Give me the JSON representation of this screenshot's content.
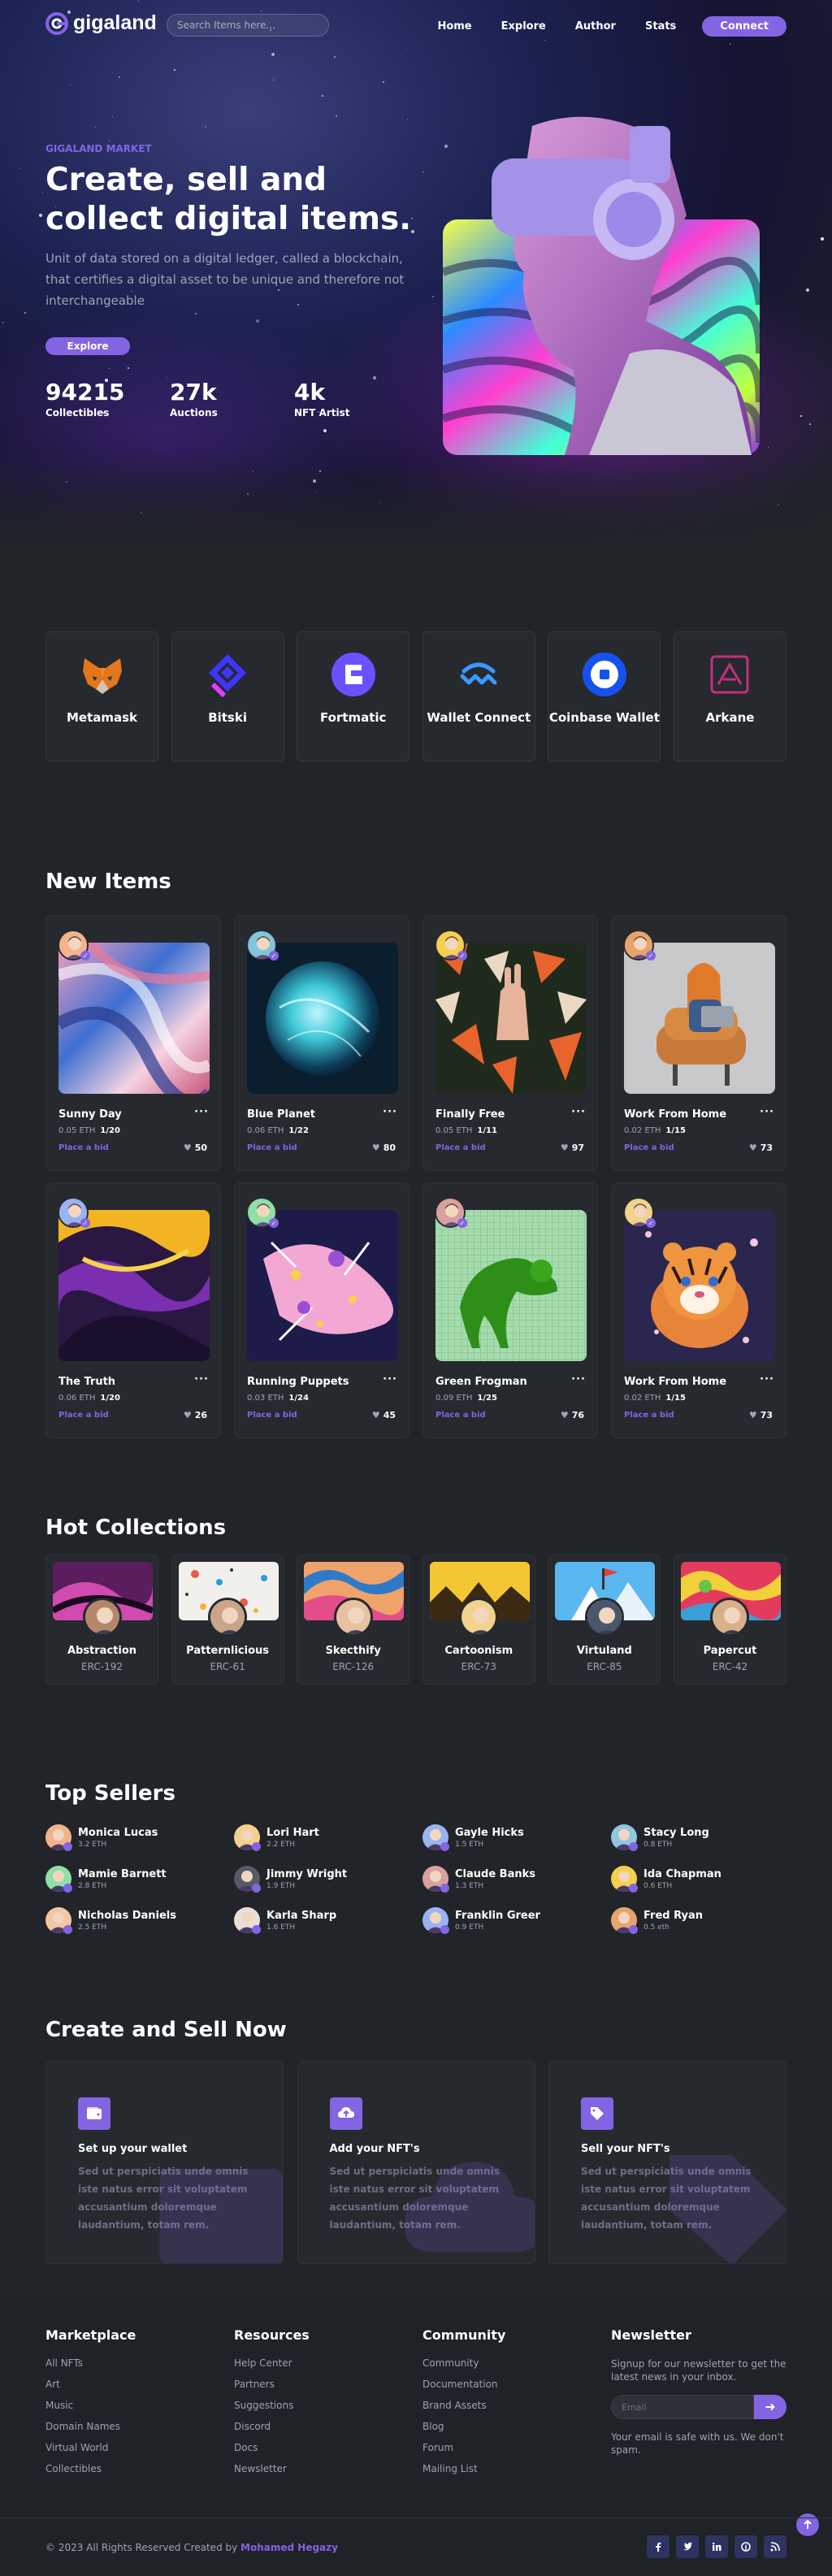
{
  "nav": {
    "brand": "gigaland",
    "search_placeholder": "Search Items here...",
    "links": [
      "Home",
      "Explore",
      "Author",
      "Stats"
    ],
    "connect_label": "Connect"
  },
  "hero": {
    "eyebrow": "GIGALAND MARKET",
    "title": "Create, sell and collect digital items.",
    "description": "Unit of data stored on a digital ledger, called a blockchain, that certifies a digital asset to be unique and therefore not interchangeable",
    "explore_label": "Explore",
    "stats": [
      {
        "value": "94215",
        "label": "Collectibles"
      },
      {
        "value": "27k",
        "label": "Auctions"
      },
      {
        "value": "4k",
        "label": "NFT Artist"
      }
    ]
  },
  "wallets": [
    {
      "name": "Metamask",
      "icon": "metamask-fox-icon"
    },
    {
      "name": "Bitski",
      "icon": "bitski-icon"
    },
    {
      "name": "Fortmatic",
      "icon": "fortmatic-icon"
    },
    {
      "name": "Wallet Connect",
      "icon": "walletconnect-icon"
    },
    {
      "name": "Coinbase Wallet",
      "icon": "coinbase-icon"
    },
    {
      "name": "Arkane",
      "icon": "arkane-icon"
    }
  ],
  "new_items": {
    "title": "New Items",
    "bid_label": "Place a bid",
    "items": [
      {
        "title": "Sunny Day",
        "price": "0.05 ETH",
        "count": "1/20",
        "likes": "50"
      },
      {
        "title": "Blue Planet",
        "price": "0.06 ETH",
        "count": "1/22",
        "likes": "80"
      },
      {
        "title": "Finally Free",
        "price": "0.05 ETH",
        "count": "1/11",
        "likes": "97"
      },
      {
        "title": "Work From Home",
        "price": "0.02 ETH",
        "count": "1/15",
        "likes": "73"
      },
      {
        "title": "The Truth",
        "price": "0.06 ETH",
        "count": "1/20",
        "likes": "26"
      },
      {
        "title": "Running Puppets",
        "price": "0.03 ETH",
        "count": "1/24",
        "likes": "45"
      },
      {
        "title": "Green Frogman",
        "price": "0.09 ETH",
        "count": "1/25",
        "likes": "76"
      },
      {
        "title": "Work From Home",
        "price": "0.02 ETH",
        "count": "1/15",
        "likes": "73"
      }
    ]
  },
  "hot_collections": {
    "title": "Hot Collections",
    "items": [
      {
        "name": "Abstraction",
        "code": "ERC-192"
      },
      {
        "name": "Patternlicious",
        "code": "ERC-61"
      },
      {
        "name": "Skecthify",
        "code": "ERC-126"
      },
      {
        "name": "Cartoonism",
        "code": "ERC-73"
      },
      {
        "name": "Virtuland",
        "code": "ERC-85"
      },
      {
        "name": "Papercut",
        "code": "ERC-42"
      }
    ]
  },
  "top_sellers": {
    "title": "Top Sellers",
    "items": [
      {
        "name": "Monica Lucas",
        "eth": "3.2 ETH"
      },
      {
        "name": "Lori Hart",
        "eth": "2.2 ETH"
      },
      {
        "name": "Gayle Hicks",
        "eth": "1.5 ETH"
      },
      {
        "name": "Stacy Long",
        "eth": "0.8 ETH"
      },
      {
        "name": "Mamie Barnett",
        "eth": "2.8 ETH"
      },
      {
        "name": "Jimmy Wright",
        "eth": "1.9 ETH"
      },
      {
        "name": "Claude Banks",
        "eth": "1.3 ETH"
      },
      {
        "name": "Ida Chapman",
        "eth": "0.6 ETH"
      },
      {
        "name": "Nicholas Daniels",
        "eth": "2.5 ETH"
      },
      {
        "name": "Karla Sharp",
        "eth": "1.6 ETH"
      },
      {
        "name": "Franklin Greer",
        "eth": "0.9 ETH"
      },
      {
        "name": "Fred Ryan",
        "eth": "0.5 eth"
      }
    ]
  },
  "create_sell": {
    "title": "Create and Sell Now",
    "items": [
      {
        "title": "Set up your wallet",
        "text": "Sed ut perspiciatis unde omnis iste natus error sit voluptatem accusantium doloremque laudantium, totam rem."
      },
      {
        "title": "Add your NFT's",
        "text": "Sed ut perspiciatis unde omnis iste natus error sit voluptatem accusantium doloremque laudantium, totam rem."
      },
      {
        "title": "Sell your NFT's",
        "text": "Sed ut perspiciatis unde omnis iste natus error sit voluptatem accusantium doloremque laudantium, totam rem."
      }
    ]
  },
  "footer": {
    "marketplace": {
      "title": "Marketplace",
      "links": [
        "All NFTs",
        "Art",
        "Music",
        "Domain Names",
        "Virtual World",
        "Collectibles"
      ]
    },
    "resources": {
      "title": "Resources",
      "links": [
        "Help Center",
        "Partners",
        "Suggestions",
        "Discord",
        "Docs",
        "Newsletter"
      ]
    },
    "community": {
      "title": "Community",
      "links": [
        "Community",
        "Documentation",
        "Brand Assets",
        "Blog",
        "Forum",
        "Mailing List"
      ]
    },
    "newsletter": {
      "title": "Newsletter",
      "text": "Signup for our newsletter to get the latest news in your inbox.",
      "email_placeholder": "Email",
      "note": "Your email is safe with us. We don't spam."
    },
    "copyright_prefix": "© 2023 All Rights Reserved Created by",
    "copyright_author": "Mohamed Hegazy",
    "socials": [
      "facebook-icon",
      "twitter-icon",
      "linkedin-icon",
      "pinterest-icon",
      "rss-icon"
    ]
  },
  "colors": {
    "accent": "#8364e2",
    "background": "#212428",
    "card": "#26292e",
    "muted": "#a2a2b5"
  }
}
